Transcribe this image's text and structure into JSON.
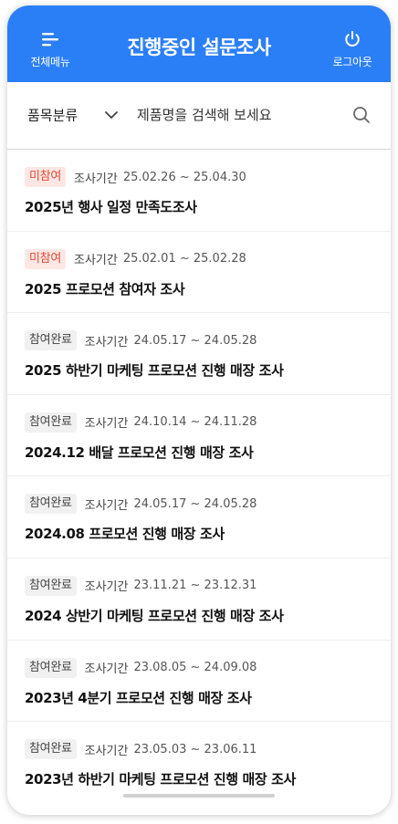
{
  "header": {
    "title": "진행중인 설문조사",
    "menu_label": "전체메뉴",
    "logout_label": "로그아웃",
    "background_color": "#2b7ff6"
  },
  "search": {
    "category_label": "품목분류",
    "placeholder": "제품명을 검색해 보세요"
  },
  "surveys": [
    {
      "status": "미참여",
      "status_type": "not-participated",
      "period_label": "조사기간",
      "period": "25.02.26 ~ 25.04.30",
      "title": "2025년 행사 일정 만족도조사"
    },
    {
      "status": "미참여",
      "status_type": "not-participated",
      "period_label": "조사기간",
      "period": "25.02.01 ~ 25.02.28",
      "title": "2025 프로모션 참여자 조사"
    },
    {
      "status": "참여완료",
      "status_type": "completed",
      "period_label": "조사기간",
      "period": "24.05.17 ~ 24.05.28",
      "title": "2025 하반기 마케팅 프로모션 진행 매장 조사"
    },
    {
      "status": "참여완료",
      "status_type": "completed",
      "period_label": "조사기간",
      "period": "24.10.14 ~ 24.11.28",
      "title": "2024.12 배달 프로모션 진행 매장 조사"
    },
    {
      "status": "참여완료",
      "status_type": "completed",
      "period_label": "조사기간",
      "period": "24.05.17 ~ 24.05.28",
      "title": "2024.08 프로모션 진행 매장 조사"
    },
    {
      "status": "참여완료",
      "status_type": "completed",
      "period_label": "조사기간",
      "period": "23.11.21 ~ 23.12.31",
      "title": "2024 상반기 마케팅 프로모션 진행 매장 조사"
    },
    {
      "status": "참여완료",
      "status_type": "completed",
      "period_label": "조사기간",
      "period": "23.08.05 ~ 24.09.08",
      "title": "2023년 4분기 프로모션 진행 매장 조사"
    },
    {
      "status": "참여완료",
      "status_type": "completed",
      "period_label": "조사기간",
      "period": "23.05.03 ~ 23.06.11",
      "title": "2023년 하반기 마케팅 프로모션 진행 매장 조사"
    }
  ]
}
